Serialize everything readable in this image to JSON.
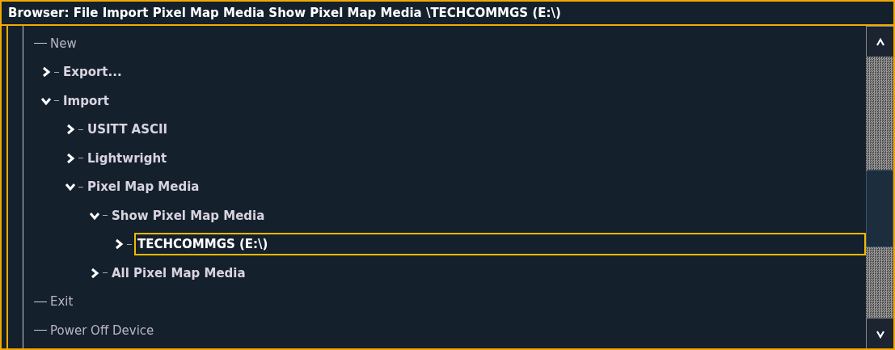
{
  "window": {
    "title": "Browser: File Import Pixel Map Media Show Pixel Map Media \\TECHCOMMGS (E:\\)"
  },
  "tree": {
    "items": [
      {
        "label": "New",
        "kind": "leaf",
        "selected": false
      },
      {
        "label": "Export...",
        "kind": "branch",
        "expanded": false,
        "selected": false
      },
      {
        "label": "Import",
        "kind": "branch",
        "expanded": true,
        "selected": false,
        "children": [
          {
            "label": "USITT ASCII",
            "kind": "branch",
            "expanded": false,
            "selected": false
          },
          {
            "label": "Lightwright",
            "kind": "branch",
            "expanded": false,
            "selected": false
          },
          {
            "label": "Pixel Map Media",
            "kind": "branch",
            "expanded": true,
            "selected": false,
            "children": [
              {
                "label": "Show Pixel Map Media",
                "kind": "branch",
                "expanded": true,
                "selected": false,
                "children": [
                  {
                    "label": "TECHCOMMGS (E:\\)",
                    "kind": "branch",
                    "expanded": false,
                    "selected": true
                  }
                ]
              },
              {
                "label": "All Pixel Map Media",
                "kind": "branch",
                "expanded": false,
                "selected": false
              }
            ]
          }
        ]
      },
      {
        "label": "Exit",
        "kind": "leaf",
        "selected": false
      },
      {
        "label": "Power Off Device",
        "kind": "leaf",
        "selected": false
      }
    ]
  }
}
